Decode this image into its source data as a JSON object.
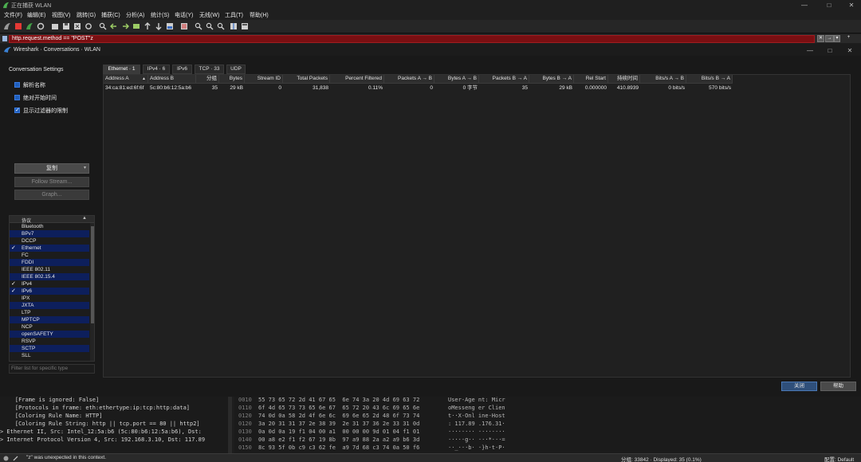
{
  "window": {
    "title": "正在捕获 WLAN",
    "controls": [
      "—",
      "□",
      "✕"
    ]
  },
  "menu": [
    "文件(F)",
    "编辑(E)",
    "视图(V)",
    "跳转(G)",
    "捕获(C)",
    "分析(A)",
    "统计(S)",
    "电话(Y)",
    "无线(W)",
    "工具(T)",
    "帮助(H)"
  ],
  "filter": {
    "value": "http.request.method == \"POST\"z",
    "state_color": "#7a0f12",
    "buttons": [
      "✕",
      "→",
      "▾",
      "+"
    ]
  },
  "dialog": {
    "title": "Wireshark · Conversations · WLAN",
    "controls": [
      "—",
      "□",
      "✕"
    ],
    "settings_heading": "Conversation Settings",
    "checkboxes": [
      {
        "label": "解析名称",
        "checked": false
      },
      {
        "label": "绝对开始时间",
        "checked": false
      },
      {
        "label": "显示过滤器的限制",
        "checked": true
      }
    ],
    "buttons": {
      "copy": "复制",
      "follow": "Follow Stream...",
      "graph": "Graph..."
    },
    "protocol_header": "协议",
    "protocols": [
      {
        "name": "Bluetooth",
        "checked": false,
        "highlight": false
      },
      {
        "name": "BPv7",
        "checked": false,
        "highlight": true
      },
      {
        "name": "DCCP",
        "checked": false,
        "highlight": false
      },
      {
        "name": "Ethernet",
        "checked": true,
        "highlight": true
      },
      {
        "name": "FC",
        "checked": false,
        "highlight": false
      },
      {
        "name": "FDDI",
        "checked": false,
        "highlight": true
      },
      {
        "name": "IEEE 802.11",
        "checked": false,
        "highlight": false
      },
      {
        "name": "IEEE 802.15.4",
        "checked": false,
        "highlight": true
      },
      {
        "name": "IPv4",
        "checked": true,
        "highlight": false
      },
      {
        "name": "IPv6",
        "checked": true,
        "highlight": true
      },
      {
        "name": "IPX",
        "checked": false,
        "highlight": false
      },
      {
        "name": "JXTA",
        "checked": false,
        "highlight": true
      },
      {
        "name": "LTP",
        "checked": false,
        "highlight": false
      },
      {
        "name": "MPTCP",
        "checked": false,
        "highlight": true
      },
      {
        "name": "NCP",
        "checked": false,
        "highlight": false
      },
      {
        "name": "openSAFETY",
        "checked": false,
        "highlight": true
      },
      {
        "name": "RSVP",
        "checked": false,
        "highlight": false
      },
      {
        "name": "SCTP",
        "checked": false,
        "highlight": true
      },
      {
        "name": "SLL",
        "checked": false,
        "highlight": false
      }
    ],
    "protocol_filter_placeholder": "Filter list for specific type",
    "tabs": [
      "Ethernet · 1",
      "IPv4 · 6",
      "IPv6",
      "TCP · 33",
      "UDP"
    ],
    "columns": [
      "Address A",
      "Address B",
      "分组",
      "Bytes",
      "Stream ID",
      "Total Packets",
      "Percent Filtered",
      "Packets A → B",
      "Bytes A → B",
      "Packets B → A",
      "Bytes B → A",
      "Rel Start",
      "持续时间",
      "Bits/s A → B",
      "Bits/s B → A"
    ],
    "sort_indicator": "▲",
    "rows": [
      [
        "34:ca:81:ed:6f:6f",
        "5c:80:b6:12:5a:b6",
        "35",
        "29 kB",
        "0",
        "31,838",
        "0.11%",
        "0",
        "0 字节",
        "35",
        "29 kB",
        "0.000000",
        "410.8939",
        "0 bits/s",
        "570 bits/s"
      ]
    ],
    "close_button": "关闭",
    "help_button": "帮助"
  },
  "details": [
    "    [Frame is ignored: False]",
    "    [Protocols in frame: eth:ethertype:ip:tcp:http:data]",
    "    [Coloring Rule Name: HTTP]",
    "    [Coloring Rule String: http || tcp.port == 80 || http2]",
    "> Ethernet II, Src: Intel_12:5a:b6 (5c:80:b6:12:5a:b6), Dst:",
    "> Internet Protocol Version 4, Src: 192.168.3.10, Dst: 117.89"
  ],
  "bytes": [
    {
      "offset": "0010",
      "hex": "55 73 65 72 2d 41 67 65  6e 74 3a 20 4d 69 63 72",
      "ascii": "User-Age nt: Micr"
    },
    {
      "offset": "0110",
      "hex": "6f 4d 65 73 73 65 6e 67  65 72 20 43 6c 69 65 6e",
      "ascii": "oMesseng er Clien"
    },
    {
      "offset": "0120",
      "hex": "74 0d 0a 58 2d 4f 6e 6c  69 6e 65 2d 48 6f 73 74",
      "ascii": "t··X-Onl ine-Host"
    },
    {
      "offset": "0120",
      "hex": "3a 20 31 31 37 2e 38 39  2e 31 37 36 2e 33 31 0d",
      "ascii": ": 117.89 .176.31·"
    },
    {
      "offset": "0130",
      "hex": "0a 0d 0a 19 f1 04 00 a1  00 00 00 9d 01 04 f1 01",
      "ascii": "········ ········"
    },
    {
      "offset": "0140",
      "hex": "00 a8 e2 f1 f2 67 19 8b  97 a9 88 2a a2 a9 b6 3d",
      "ascii": "·····g·· ···*···="
    },
    {
      "offset": "0150",
      "hex": "8c 93 5f 0b c9 c3 62 fe  a9 7d 68 c3 74 0a 50 f6",
      "ascii": "··_···b· ·}h·t·P·"
    }
  ],
  "status": {
    "message": "\"z\" was unexpected in this context.",
    "stats": "分组: 33842 · Displayed: 35 (0.1%)",
    "profile": "配置: Default"
  }
}
